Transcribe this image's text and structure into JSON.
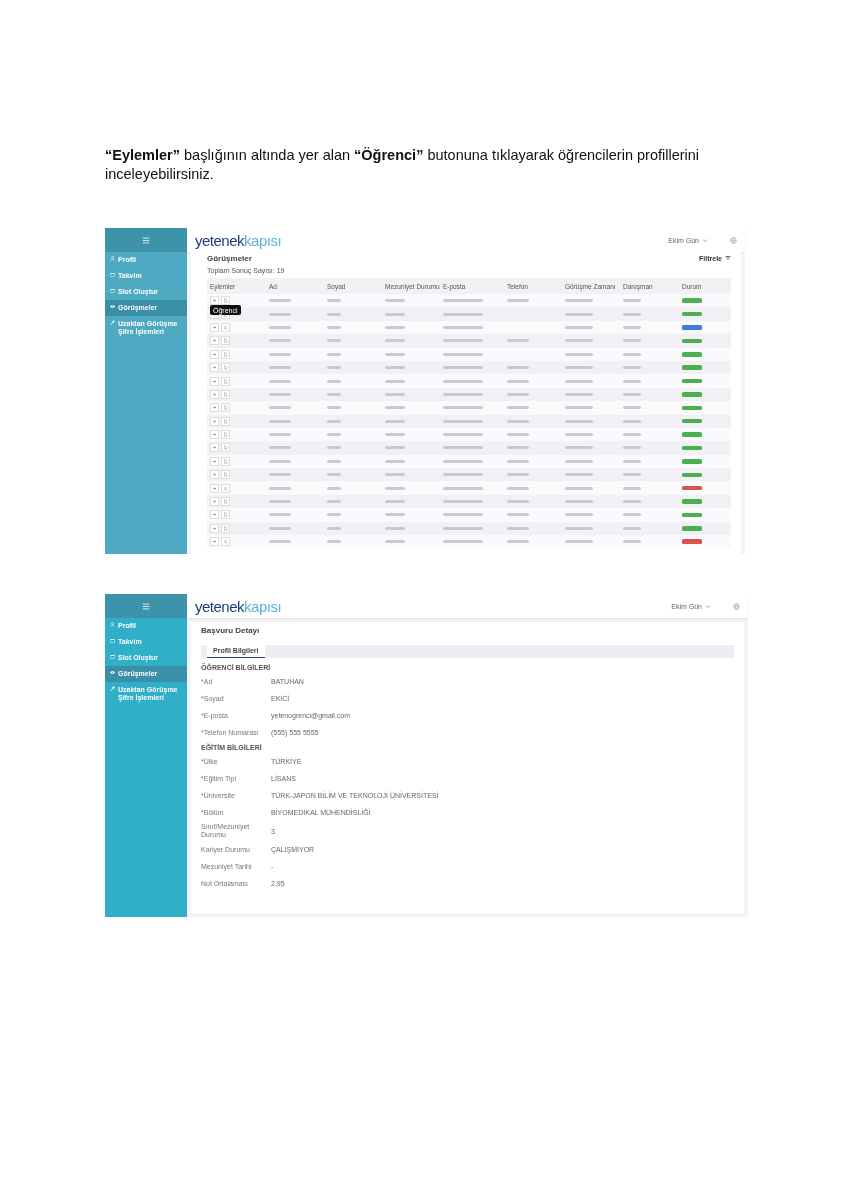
{
  "instruction": "**“Eylemler”** başlığının altında yer alan **“Öğrenci”** butonuna tıklayarak öğrencilerin profillerini inceleyebilirsiniz.",
  "screens": [
    {
      "kind": "list",
      "logo": {
        "main": "yetenek",
        "accent": "kapısı"
      },
      "user": "Ekim Gün",
      "sidebar": [
        {
          "label": "Profil",
          "kind": "person",
          "selected": false
        },
        {
          "label": "Takvim",
          "kind": "calendar",
          "selected": false
        },
        {
          "label": "Slot Oluştur",
          "kind": "calendar",
          "selected": false
        },
        {
          "label": "Görüşmeler",
          "kind": "eye",
          "selected": true
        },
        {
          "label": "Uzaktan Görüşme Şifre İşlemleri",
          "kind": "key",
          "selected": false
        }
      ],
      "title": "Görüşmeler",
      "filter": "Filtrele",
      "total": "Toplam Sonuç Sayısı: 19",
      "columns": [
        "Eylemler",
        "Ad",
        "Soyad",
        "Mezuniyet Durumu",
        "E-posta",
        "Telefon",
        "Görüşme Zamanı",
        "Danışman",
        "Durum"
      ],
      "tooltip": "Öğrenci",
      "rows": [
        {
          "kind": "document",
          "color": "#4caf50",
          "phone_blank": false
        },
        {
          "kind": "document",
          "color": "#4caf50",
          "phone_blank": true
        },
        {
          "kind": "person",
          "color": "#3d7fd6",
          "phone_blank": true
        },
        {
          "kind": "document",
          "color": "#4caf50",
          "phone_blank": false
        },
        {
          "kind": "document",
          "color": "#4caf50",
          "phone_blank": true
        },
        {
          "kind": "document",
          "color": "#4caf50",
          "phone_blank": false
        },
        {
          "kind": "document",
          "color": "#4caf50",
          "phone_blank": false
        },
        {
          "kind": "document",
          "color": "#4caf50",
          "phone_blank": false
        },
        {
          "kind": "document",
          "color": "#4caf50",
          "phone_blank": false
        },
        {
          "kind": "document",
          "color": "#4caf50",
          "phone_blank": false
        },
        {
          "kind": "document",
          "color": "#4caf50",
          "phone_blank": false
        },
        {
          "kind": "document",
          "color": "#4caf50",
          "phone_blank": false
        },
        {
          "kind": "document",
          "color": "#4caf50",
          "phone_blank": false
        },
        {
          "kind": "document",
          "color": "#4caf50",
          "phone_blank": false
        },
        {
          "kind": "person",
          "color": "#d9534f",
          "phone_blank": false
        },
        {
          "kind": "document",
          "color": "#4caf50",
          "phone_blank": false
        },
        {
          "kind": "document",
          "color": "#4caf50",
          "phone_blank": false
        },
        {
          "kind": "document",
          "color": "#4caf50",
          "phone_blank": false
        },
        {
          "kind": "person",
          "color": "#d9534f",
          "phone_blank": false
        }
      ]
    },
    {
      "kind": "detail",
      "logo": {
        "main": "yetenek",
        "accent": "kapısı"
      },
      "user": "Ekim Gün",
      "sidebar": [
        {
          "label": "Profil",
          "kind": "person",
          "selected": false
        },
        {
          "label": "Takvim",
          "kind": "calendar",
          "selected": false
        },
        {
          "label": "Slot Oluştur",
          "kind": "calendar",
          "selected": false
        },
        {
          "label": "Görüşmeler",
          "kind": "eye",
          "selected": true
        },
        {
          "label": "Uzaktan Görüşme Şifre İşlemleri",
          "kind": "key",
          "selected": false
        }
      ],
      "title": "Başvuru Detayı",
      "tab": "Profil Bilgileri",
      "sections": [
        {
          "heading": "ÖĞRENCİ BİLGİLERİ",
          "fields": [
            {
              "label": "*Ad",
              "value": "BATUHAN"
            },
            {
              "label": "*Soyad",
              "value": "EKİCİ"
            },
            {
              "label": "*E-posta",
              "value": "yetenogrenci@gmail.com"
            },
            {
              "label": "*Telefon Numarası",
              "value": "(555) 555 5555"
            }
          ]
        },
        {
          "heading": "EĞİTİM BİLGİLERİ",
          "fields": [
            {
              "label": "*Ülke",
              "value": "TÜRKİYE"
            },
            {
              "label": "*Eğitim Tipi",
              "value": "LİSANS"
            },
            {
              "label": "*Üniversite",
              "value": "TÜRK-JAPON BİLİM VE TEKNOLOJİ ÜNİVERSİTESİ"
            },
            {
              "label": "*Bölüm",
              "value": "BİYOMEDİKAL MÜHENDİSLİĞİ"
            },
            {
              "label": "Sınıf/Mezuniyet Durumu",
              "value": "3"
            },
            {
              "label": "Kariyer Durumu",
              "value": "ÇALIŞMIYOR"
            },
            {
              "label": "Mezuniyet Tarihi",
              "value": "-"
            },
            {
              "label": "Not Ortalaması",
              "value": "2,95"
            }
          ]
        }
      ]
    }
  ]
}
